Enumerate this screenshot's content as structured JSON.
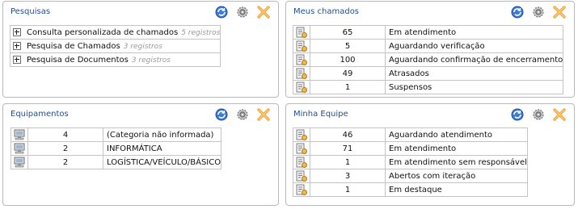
{
  "pesquisas": {
    "title": "Pesquisas",
    "tools": [
      "refresh-icon",
      "settings-icon",
      "close-icon"
    ],
    "rows": [
      {
        "label": "Consulta personalizada de chamados",
        "count": "5 registros"
      },
      {
        "label": "Pesquisa de Chamados",
        "count": "3 registros"
      },
      {
        "label": "Pesquisa de Documentos",
        "count": "3 registros"
      }
    ]
  },
  "meus_chamados": {
    "title": "Meus chamados",
    "rows": [
      {
        "num": "65",
        "label": "Em atendimento"
      },
      {
        "num": "5",
        "label": "Aguardando verificação"
      },
      {
        "num": "100",
        "label": "Aguardando confirmação de encerramento"
      },
      {
        "num": "49",
        "label": "Atrasados"
      },
      {
        "num": "1",
        "label": "Suspensos"
      }
    ]
  },
  "equipamentos": {
    "title": "Equipamentos",
    "rows": [
      {
        "num": "4",
        "label": "(Categoria não informada)"
      },
      {
        "num": "2",
        "label": "INFORMÁTICA"
      },
      {
        "num": "2",
        "label": "LOGÍSTICA/VEÍCULO/BÁSICO"
      }
    ]
  },
  "minha_equipe": {
    "title": "Minha Equipe",
    "rows": [
      {
        "num": "46",
        "label": "Aguardando atendimento"
      },
      {
        "num": "71",
        "label": "Em atendimento"
      },
      {
        "num": "1",
        "label": "Em atendimento sem responsável"
      },
      {
        "num": "3",
        "label": "Abertos com iteração"
      },
      {
        "num": "1",
        "label": "Em destaque"
      }
    ]
  },
  "colors": {
    "title": "#1f4e91",
    "border": "#b9b9b9",
    "close": "#f2a33a",
    "refresh": "#2a66c9"
  }
}
